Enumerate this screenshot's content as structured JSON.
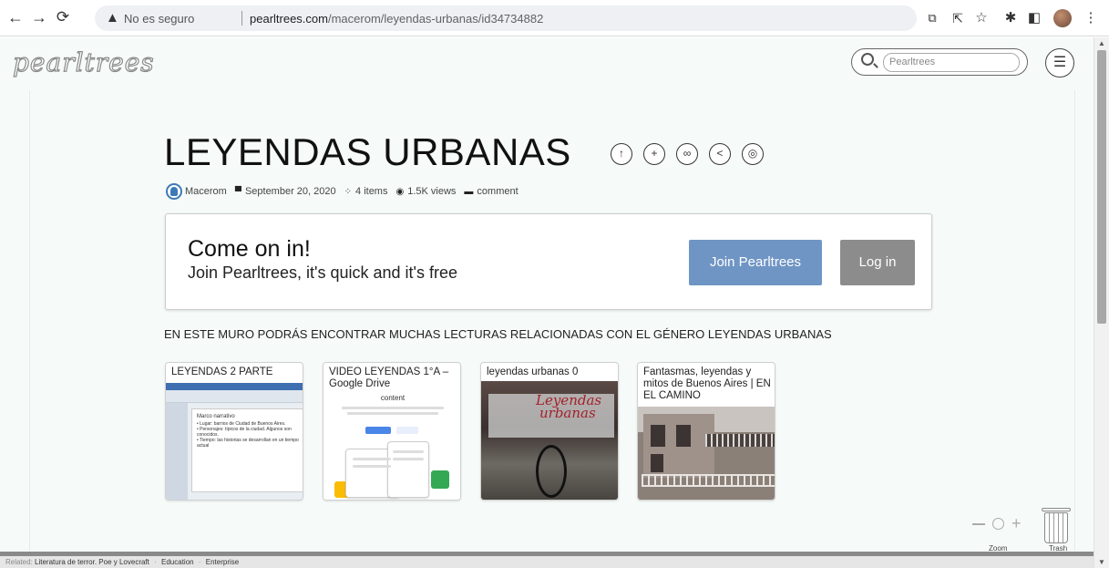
{
  "browser": {
    "security_text": "No es seguro",
    "url_host": "pearltrees.com",
    "url_path": "/macerom/leyendas-urbanas/id34734882",
    "back_icon": "arrow-left-icon",
    "forward_icon": "arrow-right-icon",
    "reload_icon": "reload-icon"
  },
  "site": {
    "logo": "pearltrees",
    "search_placeholder": "Pearltrees"
  },
  "collection": {
    "title": "LEYENDAS URBANAS",
    "author": "Macerom",
    "date": "September 20, 2020",
    "items": "4 items",
    "views": "1.5K views",
    "comment": "comment"
  },
  "join": {
    "title": "Come on in!",
    "subtitle": "Join Pearltrees, it's quick and it's free",
    "join_label": "Join Pearltrees",
    "login_label": "Log in"
  },
  "description": "EN ESTE MURO PODRÁS ENCONTRAR MUCHAS LECTURAS RELACIONADAS CON EL GÉNERO LEYENDAS URBANAS",
  "cards": [
    {
      "title": "LEYENDAS 2 PARTE",
      "thumb_head": "Marco narrativo",
      "thumb_lines": [
        "• Lugar: barrios de Ciudad de Buenos Aires.",
        "• Personajes: típicos de la ciudad. Algunos son conocidos.",
        "• Tiempo: las historias se desarrollan en un tiempo actual"
      ]
    },
    {
      "title": "VIDEO LEYENDAS 1°A – Google Drive",
      "thumb_word": "content"
    },
    {
      "title": "leyendas urbanas 0",
      "thumb_logo_1": "Leyendas",
      "thumb_logo_2": "urbanas"
    },
    {
      "title": "Fantasmas, leyendas y mitos de Buenos Aires | EN EL CAMINO"
    }
  ],
  "tools": {
    "zoom_label": "Zoom",
    "trash_label": "Trash"
  },
  "footer": {
    "related_label": "Related:",
    "links": [
      "Literatura de terror. Poe y Lovecraft",
      "Education",
      "Enterprise"
    ]
  },
  "colors": {
    "join_button": "#6f95c4",
    "login_button": "#8c8c8c",
    "avatar": "#3d7ab5",
    "page_bg": "#f6fbf9"
  }
}
